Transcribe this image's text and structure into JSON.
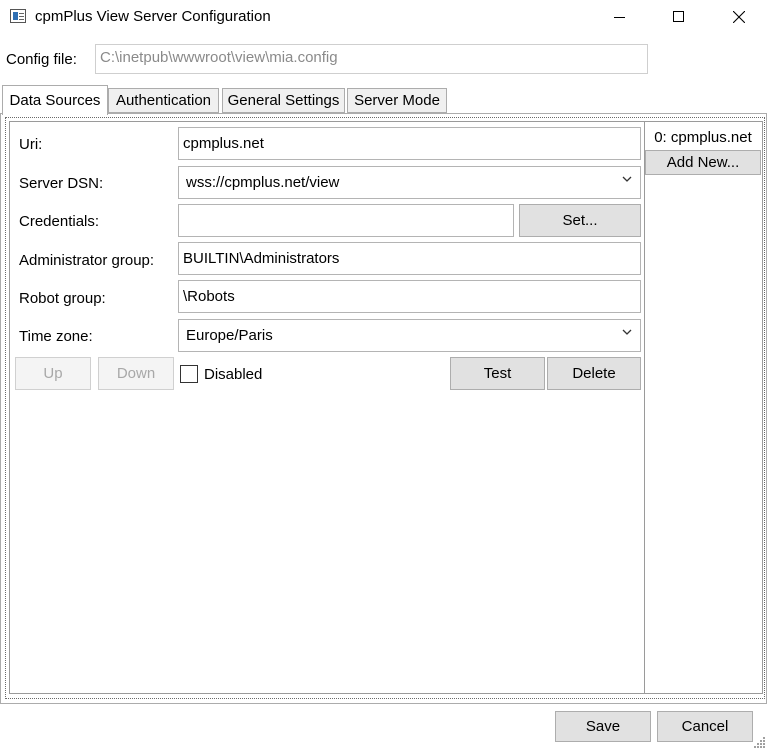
{
  "window": {
    "title": "cpmPlus View Server Configuration",
    "controls": [
      "minimize",
      "maximize",
      "close"
    ]
  },
  "config": {
    "label": "Config file:",
    "value": "C:\\inetpub\\wwwroot\\view\\mia.config"
  },
  "tabs": [
    {
      "label": "Data Sources",
      "active": true
    },
    {
      "label": "Authentication",
      "active": false
    },
    {
      "label": "General Settings",
      "active": false
    },
    {
      "label": "Server Mode",
      "active": false
    }
  ],
  "form": {
    "uri": {
      "label": "Uri:",
      "value": "cpmplus.net"
    },
    "server_dsn": {
      "label": "Server DSN:",
      "value": "wss://cpmplus.net/view"
    },
    "credentials": {
      "label": "Credentials:",
      "value": "",
      "button": "Set..."
    },
    "admin_group": {
      "label": "Administrator group:",
      "value": "BUILTIN\\Administrators"
    },
    "robot_group": {
      "label": "Robot group:",
      "value": "\\Robots"
    },
    "time_zone": {
      "label": "Time zone:",
      "value": "Europe/Paris"
    },
    "up_button": "Up",
    "down_button": "Down",
    "disabled_label": "Disabled",
    "disabled_checked": false,
    "test_button": "Test",
    "delete_button": "Delete"
  },
  "datasource_list": {
    "items": [
      "0: cpmplus.net"
    ],
    "add_button": "Add New..."
  },
  "footer": {
    "save": "Save",
    "cancel": "Cancel"
  }
}
